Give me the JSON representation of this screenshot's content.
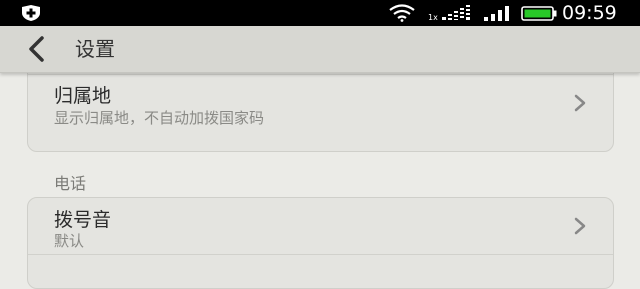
{
  "status_bar": {
    "time": "09:59",
    "network_type": "1x",
    "icons": [
      "shield-plus-icon",
      "wifi-icon",
      "1x-signal-icon",
      "cell-signal-icon",
      "battery-icon"
    ],
    "battery_color": "#28c828"
  },
  "header": {
    "back_icon": "chevron-left-icon",
    "title": "设置"
  },
  "sections": [
    {
      "items": [
        {
          "title": "归属地",
          "subtitle": "显示归属地，不自动加拨国家码"
        }
      ]
    },
    {
      "header": "电话",
      "items": [
        {
          "title": "拨号音",
          "subtitle": "默认"
        }
      ]
    }
  ]
}
